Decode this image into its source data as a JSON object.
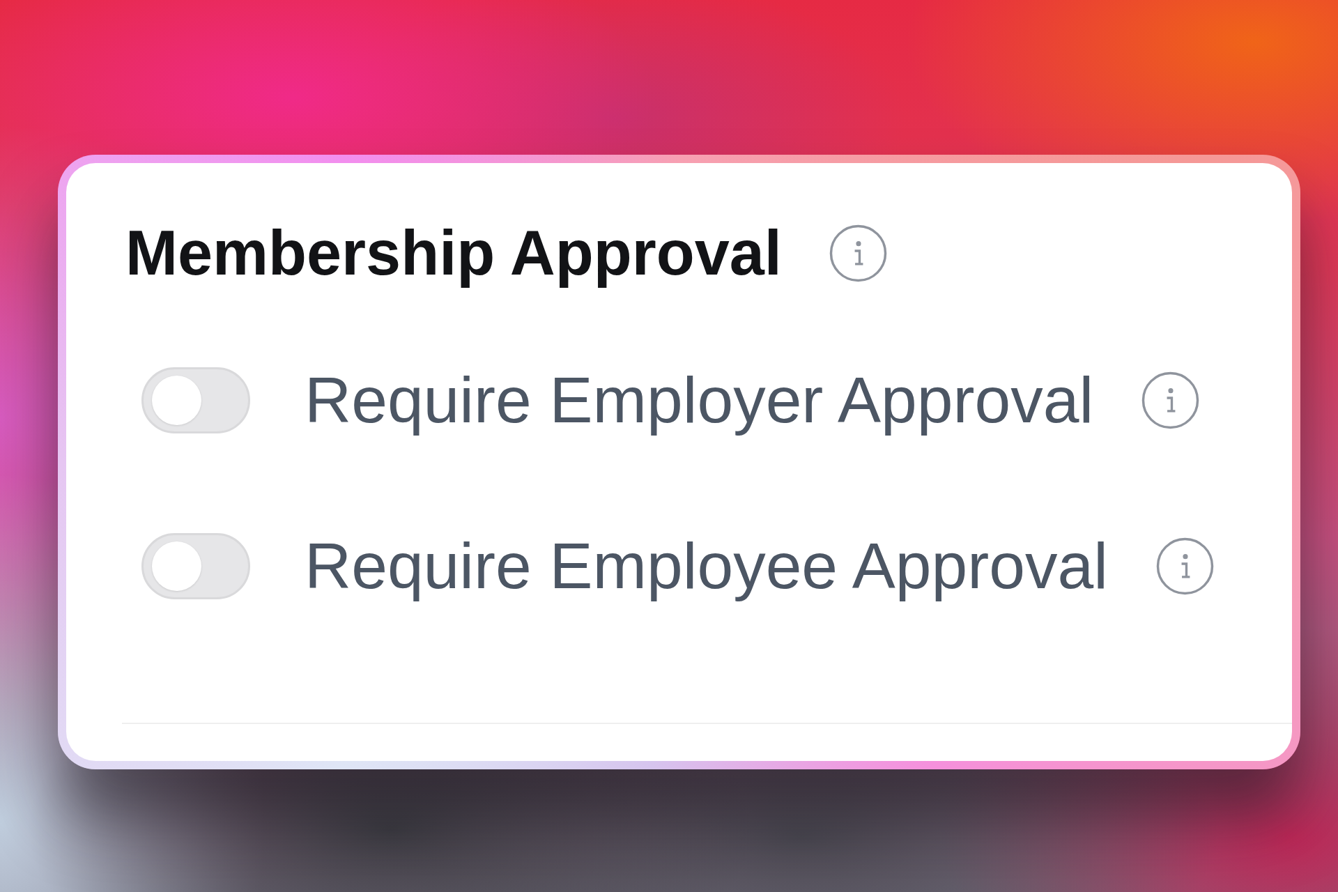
{
  "card": {
    "title": "Membership Approval",
    "settings": [
      {
        "label": "Require Employer Approval",
        "on": false
      },
      {
        "label": "Require Employee Approval",
        "on": false
      }
    ]
  }
}
